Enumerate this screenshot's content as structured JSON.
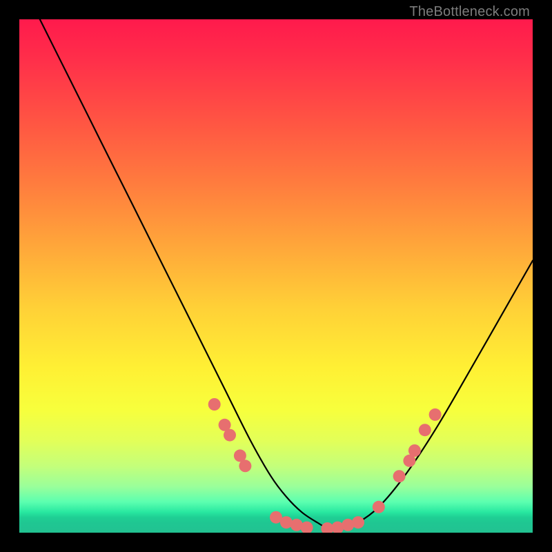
{
  "watermark": {
    "text": "TheBottleneck.com"
  },
  "chart_data": {
    "type": "line",
    "title": "",
    "xlabel": "",
    "ylabel": "",
    "xlim": [
      0,
      100
    ],
    "ylim": [
      0,
      100
    ],
    "grid": false,
    "series": [
      {
        "name": "curve",
        "x": [
          4,
          10,
          16,
          22,
          28,
          34,
          40,
          45,
          49,
          52,
          55,
          58,
          60,
          63,
          66,
          70,
          75,
          81,
          88,
          96,
          100
        ],
        "y": [
          100,
          88,
          76,
          64,
          52,
          40,
          28,
          18,
          11,
          7,
          4,
          2,
          1,
          1,
          2,
          5,
          11,
          20,
          32,
          46,
          53
        ]
      }
    ],
    "markers": {
      "name": "highlight-dots",
      "color": "#e76f6f",
      "points": [
        {
          "x": 38,
          "y": 25
        },
        {
          "x": 40,
          "y": 21
        },
        {
          "x": 41,
          "y": 19
        },
        {
          "x": 43,
          "y": 15
        },
        {
          "x": 44,
          "y": 13
        },
        {
          "x": 50,
          "y": 3
        },
        {
          "x": 52,
          "y": 2
        },
        {
          "x": 54,
          "y": 1.5
        },
        {
          "x": 56,
          "y": 1
        },
        {
          "x": 60,
          "y": 0.8
        },
        {
          "x": 62,
          "y": 1
        },
        {
          "x": 64,
          "y": 1.5
        },
        {
          "x": 66,
          "y": 2
        },
        {
          "x": 70,
          "y": 5
        },
        {
          "x": 74,
          "y": 11
        },
        {
          "x": 76,
          "y": 14
        },
        {
          "x": 77,
          "y": 16
        },
        {
          "x": 79,
          "y": 20
        },
        {
          "x": 81,
          "y": 23
        }
      ]
    },
    "background_gradient": {
      "top": "#ff1a4c",
      "mid": "#fff034",
      "bottom": "#22c291"
    }
  }
}
